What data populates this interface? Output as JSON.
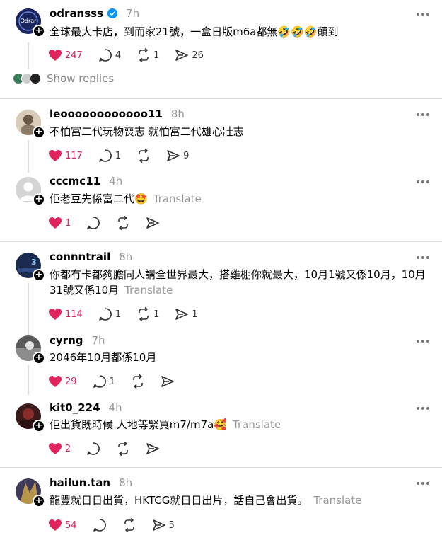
{
  "posts": [
    {
      "username": "odransss",
      "verified": true,
      "time": "7h",
      "text": "全球最大卡店，到而家21號，一盒日版m6a都無🤣🤣🤣顛到",
      "likes": "247",
      "replies": "4",
      "reposts": "1",
      "shares": "26",
      "avatar_label": "Odrar"
    },
    {
      "username": "leoooooooooooo11",
      "time": "8h",
      "text": "不怕富二代玩物喪志 就怕富二代雄心壯志",
      "likes": "117",
      "replies": "1",
      "shares": "9"
    },
    {
      "username": "cccmc11",
      "time": "4h",
      "text": "佢老豆先係富二代🤩",
      "translate": "Translate",
      "likes": "1"
    },
    {
      "username": "connntrail",
      "time": "8h",
      "text": "你都冇卡都夠膽同人講全世界最大，搭雞棚你就最大，10月1號又係10月，10月31號又係10月",
      "translate": "Translate",
      "likes": "114",
      "replies": "1",
      "reposts": "1",
      "shares": "1"
    },
    {
      "username": "cyrng",
      "time": "7h",
      "text": "2046年10月都係10月",
      "likes": "29",
      "replies": "1"
    },
    {
      "username": "kit0_224",
      "time": "4h",
      "text": "佢出貨既時候 人地等緊買m7/m7a🥰",
      "translate": "Translate",
      "likes": "2"
    },
    {
      "username": "hailun.tan",
      "time": "8h",
      "text": "龍豐就日日出貨，HKTCG就日日出片，話自己會出貨。",
      "translate": "Translate",
      "likes": "54",
      "shares": "5"
    }
  ],
  "show_replies_label": "Show replies",
  "colors": {
    "like": "#e0245e",
    "verified": "#0095f6",
    "muted": "#999999",
    "divider": "#dcdcdc"
  }
}
